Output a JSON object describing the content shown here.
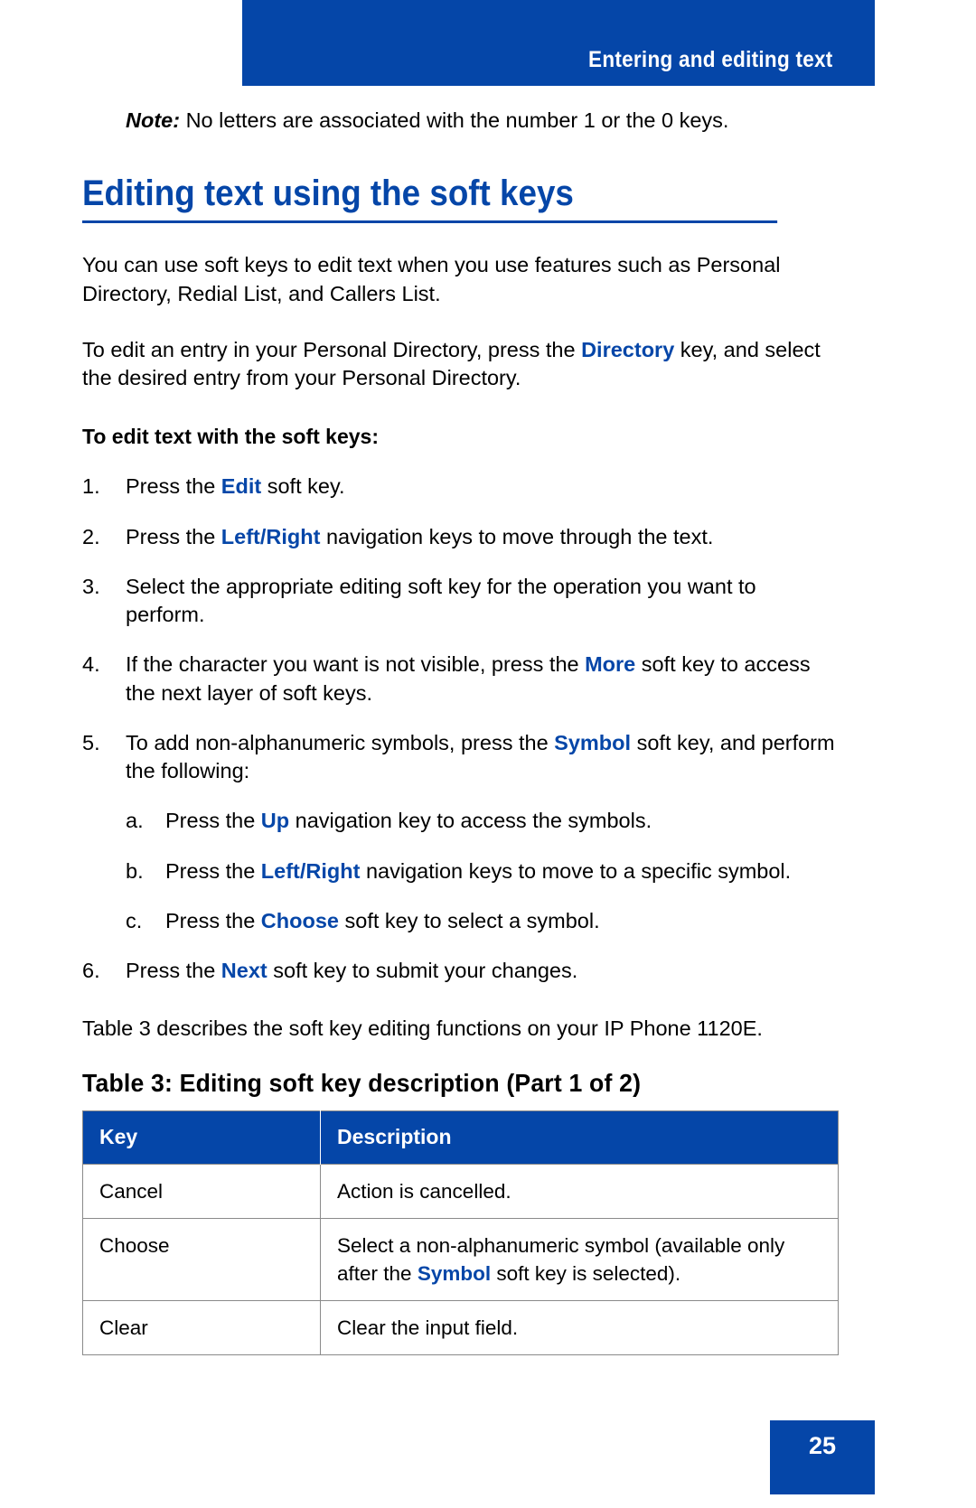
{
  "header": {
    "running_title": "Entering and editing text",
    "band_color": "#0546A8"
  },
  "note": {
    "label": "Note:",
    "text": "No letters are associated with the number 1 or the 0 keys."
  },
  "section": {
    "title": "Editing text using the soft keys"
  },
  "paragraphs": {
    "intro1_a": "You can use soft keys to edit text when you use features such as Personal Directory, Redial List, and Callers List.",
    "intro2_a": "To edit an entry in your Personal Directory, press the ",
    "intro2_kw": "Directory",
    "intro2_b": " key, and select the desired entry from your Personal Directory.",
    "table_intro": "Table 3 describes the soft key editing functions on your IP Phone 1120E."
  },
  "procedure": {
    "heading": "To edit text with the soft keys:",
    "steps": [
      {
        "marker": "1.",
        "pre": "Press the ",
        "kw": "Edit",
        "post": " soft key.",
        "level": "main"
      },
      {
        "marker": "2.",
        "pre": "Press the ",
        "kw": "Left/Right",
        "post": " navigation keys to move through the text.",
        "level": "main"
      },
      {
        "marker": "3.",
        "pre": "Select the appropriate editing soft key for the operation you want to perform.",
        "kw": "",
        "post": "",
        "level": "main"
      },
      {
        "marker": "4.",
        "pre": "If the character you want is not visible, press the ",
        "kw": "More",
        "post": " soft key to access the next layer of soft keys.",
        "level": "main"
      },
      {
        "marker": "5.",
        "pre": "To add non-alphanumeric symbols, press the ",
        "kw": "Symbol",
        "post": " soft key, and perform the following:",
        "level": "main"
      },
      {
        "marker": "a.",
        "pre": "Press the ",
        "kw": "Up",
        "post": " navigation key to access the symbols.",
        "level": "sub"
      },
      {
        "marker": "b.",
        "pre": "Press the ",
        "kw": "Left/Right",
        "post": " navigation keys to move to a specific symbol.",
        "level": "sub"
      },
      {
        "marker": "c.",
        "pre": "Press the ",
        "kw": "Choose",
        "post": " soft key to select a symbol.",
        "level": "sub"
      },
      {
        "marker": "6.",
        "pre": "Press the ",
        "kw": "Next",
        "post": " soft key to submit your changes.",
        "level": "main"
      }
    ]
  },
  "table": {
    "caption": "Table 3: Editing soft key description (Part 1 of 2)",
    "headers": [
      "Key",
      "Description"
    ],
    "header_bg": "#0546A8",
    "rows": [
      {
        "key": "Cancel",
        "desc_pre": "Action is cancelled.",
        "desc_kw": "",
        "desc_post": ""
      },
      {
        "key": "Choose",
        "desc_pre": "Select a non-alphanumeric symbol (available only after the ",
        "desc_kw": "Symbol",
        "desc_post": " soft key is selected)."
      },
      {
        "key": "Clear",
        "desc_pre": "Clear the input field.",
        "desc_kw": "",
        "desc_post": ""
      }
    ]
  },
  "footer": {
    "page_number": "25"
  }
}
